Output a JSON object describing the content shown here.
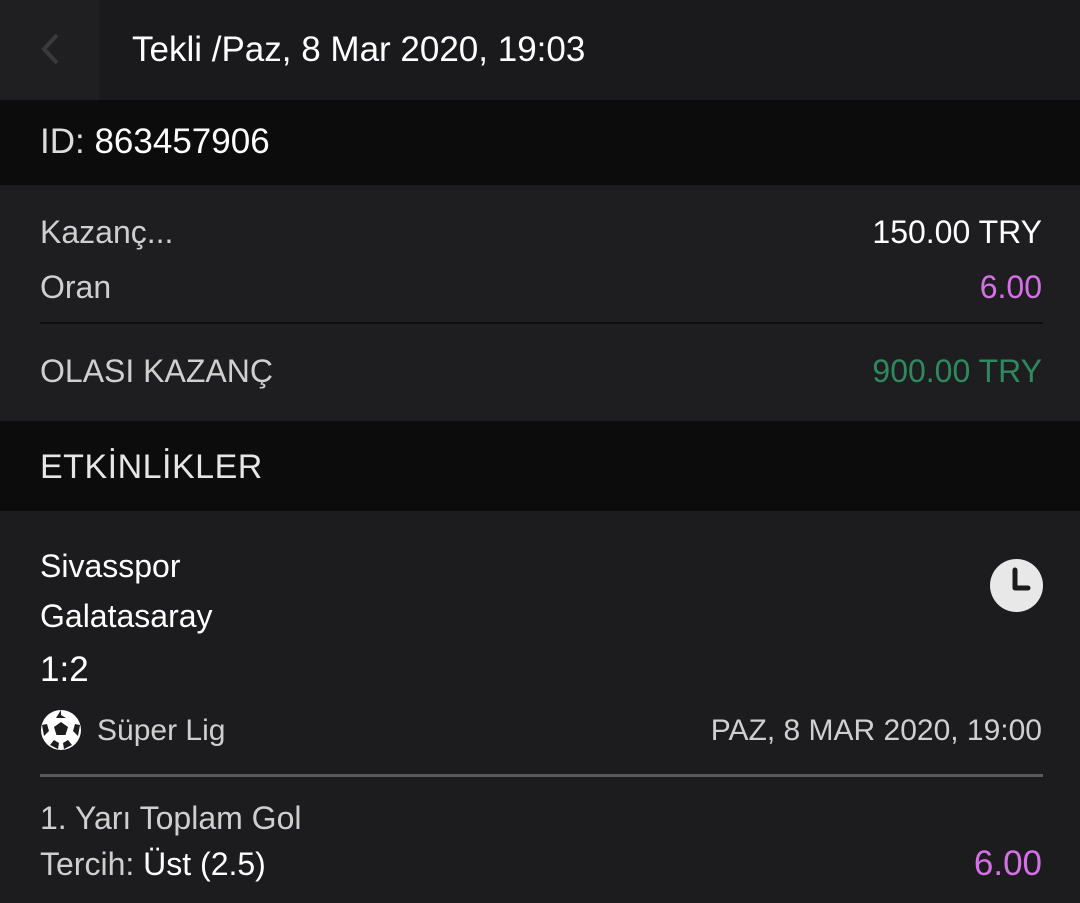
{
  "header": {
    "back_icon": "chevron-left-icon",
    "title": "Tekli /Paz, 8 Mar 2020, 19:03"
  },
  "bet": {
    "id_label": "ID:",
    "id_value": "863457906"
  },
  "summary": {
    "stake_label": "Kazanç...",
    "stake_value": "150.00 TRY",
    "odds_label": "Oran",
    "odds_value": "6.00",
    "payout_label": "OLASI KAZANÇ",
    "payout_value": "900.00 TRY"
  },
  "events_section": {
    "title": "ETKİNLİKLER"
  },
  "event": {
    "home_team": "Sivasspor",
    "away_team": "Galatasaray",
    "score": "1:2",
    "status_icon": "clock-icon",
    "sport_icon": "soccer-ball-icon",
    "league": "Süper Lig",
    "date": "PAZ, 8 MAR 2020, 19:00",
    "market": "1. Yarı Toplam Gol",
    "pick_label": "Tercih:",
    "pick_value": "Üst (2.5)",
    "pick_odds": "6.00"
  },
  "colors": {
    "odds": "#d670e6",
    "payout": "#2e8a5e",
    "stake": "#ffffff"
  }
}
